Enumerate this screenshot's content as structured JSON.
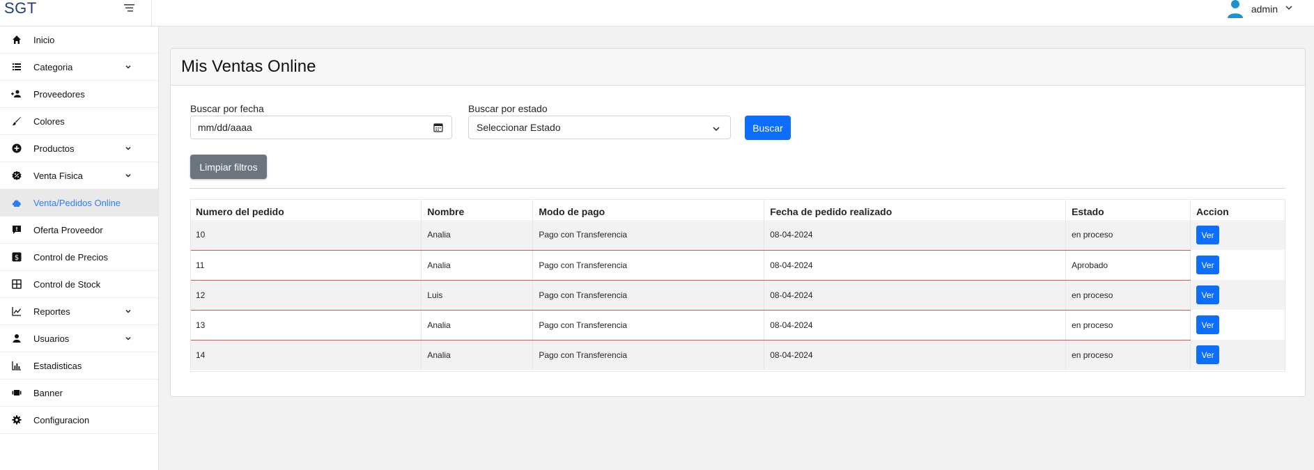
{
  "app": {
    "brand": "SGT"
  },
  "user": {
    "name": "admin"
  },
  "sidebar": {
    "items": [
      {
        "label": "Inicio",
        "icon": "home-icon",
        "chevron": false
      },
      {
        "label": "Categoria",
        "icon": "list-icon",
        "chevron": true
      },
      {
        "label": "Proveedores",
        "icon": "users-icon",
        "chevron": false
      },
      {
        "label": "Colores",
        "icon": "brush-icon",
        "chevron": false
      },
      {
        "label": "Productos",
        "icon": "plus-circle-icon",
        "chevron": true
      },
      {
        "label": "Venta Fisica",
        "icon": "badge-percent-icon",
        "chevron": true
      },
      {
        "label": "Venta/Pedidos Online",
        "icon": "cloud-icon",
        "chevron": false,
        "active": true
      },
      {
        "label": "Oferta Proveedor",
        "icon": "chat-alert-icon",
        "chevron": false
      },
      {
        "label": "Control de Precios",
        "icon": "dollar-icon",
        "chevron": false
      },
      {
        "label": "Control de Stock",
        "icon": "grid-icon",
        "chevron": false
      },
      {
        "label": "Reportes",
        "icon": "line-chart-icon",
        "chevron": true
      },
      {
        "label": "Usuarios",
        "icon": "person-icon",
        "chevron": true
      },
      {
        "label": "Estadisticas",
        "icon": "bar-chart-icon",
        "chevron": false
      },
      {
        "label": "Banner",
        "icon": "banner-icon",
        "chevron": false
      },
      {
        "label": "Configuracion",
        "icon": "gear-icon",
        "chevron": false
      }
    ]
  },
  "main": {
    "title": "Mis Ventas Online",
    "filters": {
      "date_label": "Buscar por fecha",
      "date_placeholder": "mm/dd/aaaa",
      "state_label": "Buscar por estado",
      "state_selected": "Seleccionar Estado",
      "search_button": "Buscar",
      "clear_button": "Limpiar filtros"
    },
    "table": {
      "columns": [
        "Numero del pedido",
        "Nombre",
        "Modo de pago",
        "Fecha de pedido realizado",
        "Estado",
        "Accion"
      ],
      "rows": [
        {
          "numero": "10",
          "nombre": "Analia",
          "pago": "Pago con Transferencia",
          "fecha": "08-04-2024",
          "estado": "en proceso",
          "accion": "Ver"
        },
        {
          "numero": "11",
          "nombre": "Analia",
          "pago": "Pago con Transferencia",
          "fecha": "08-04-2024",
          "estado": "Aprobado",
          "accion": "Ver"
        },
        {
          "numero": "12",
          "nombre": "Luis",
          "pago": "Pago con Transferencia",
          "fecha": "08-04-2024",
          "estado": "en proceso",
          "accion": "Ver"
        },
        {
          "numero": "13",
          "nombre": "Analia",
          "pago": "Pago con Transferencia",
          "fecha": "08-04-2024",
          "estado": "en proceso",
          "accion": "Ver"
        },
        {
          "numero": "14",
          "nombre": "Analia",
          "pago": "Pago con Transferencia",
          "fecha": "08-04-2024",
          "estado": "en proceso",
          "accion": "Ver"
        }
      ]
    }
  },
  "colors": {
    "primary": "#0d6efd",
    "secondary": "#6c757d",
    "active_text": "#2d7df6",
    "row_separator": "#d9534f"
  }
}
